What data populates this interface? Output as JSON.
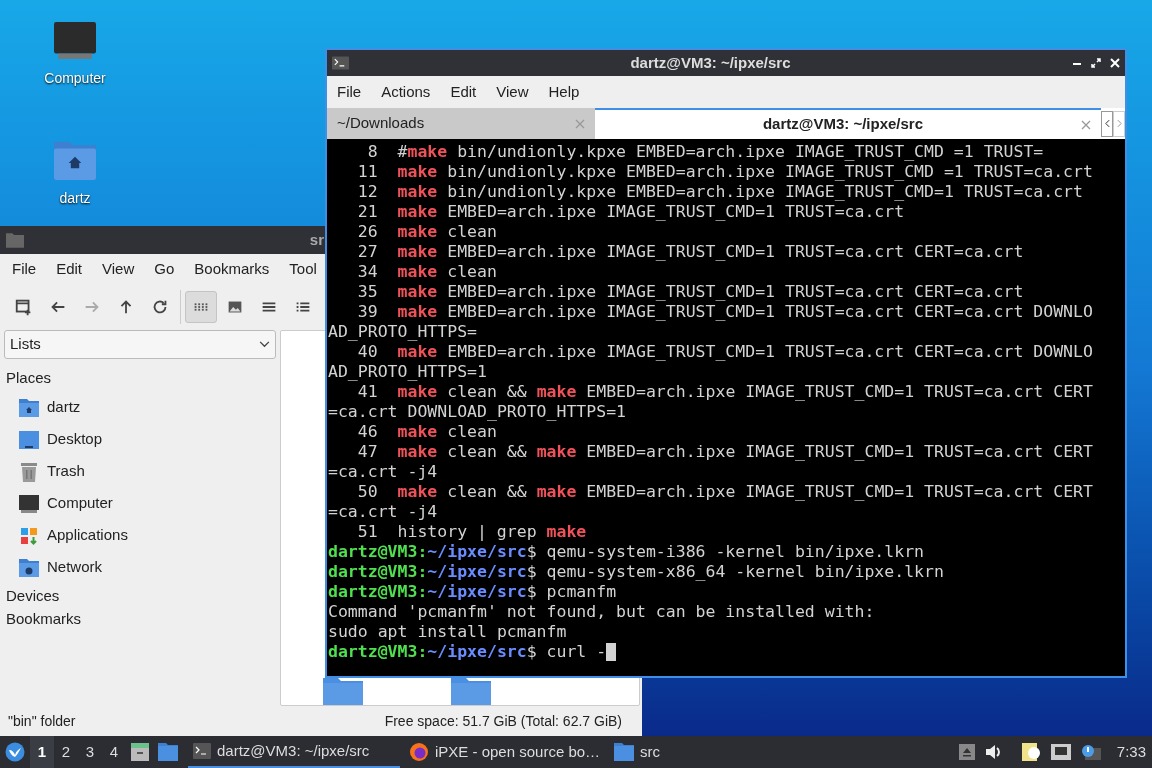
{
  "desktop_icons": [
    {
      "label": "Computer",
      "kind": "computer"
    },
    {
      "label": "dartz",
      "kind": "home"
    }
  ],
  "file_manager": {
    "title": "sr",
    "menu": [
      "File",
      "Edit",
      "View",
      "Go",
      "Bookmarks",
      "Tool"
    ],
    "toolbar": [
      {
        "kind": "new-tab",
        "selected": false
      },
      {
        "kind": "back",
        "selected": false
      },
      {
        "kind": "forward",
        "selected": false
      },
      {
        "kind": "up",
        "selected": false
      },
      {
        "kind": "reload",
        "selected": false
      },
      {
        "kind": "icons",
        "selected": true
      },
      {
        "kind": "thumbnails",
        "selected": false
      },
      {
        "kind": "compact",
        "selected": false
      },
      {
        "kind": "details",
        "selected": false
      }
    ],
    "side_select": "Lists",
    "places_heading": "Places",
    "places": [
      {
        "label": "dartz",
        "kind": "home"
      },
      {
        "label": "Desktop",
        "kind": "desktop"
      },
      {
        "label": "Trash",
        "kind": "trash"
      },
      {
        "label": "Computer",
        "kind": "computer"
      },
      {
        "label": "Applications",
        "kind": "apps"
      },
      {
        "label": "Network",
        "kind": "network"
      }
    ],
    "sections": [
      "Devices",
      "Bookmarks"
    ],
    "status_left": "\"bin\" folder",
    "status_right": "Free space: 51.7 GiB (Total: 62.7 GiB)"
  },
  "terminal": {
    "title": "dartz@VM3: ~/ipxe/src",
    "menu": [
      "File",
      "Actions",
      "Edit",
      "View",
      "Help"
    ],
    "tabs": [
      {
        "label": "~/Downloads",
        "selected": false
      },
      {
        "label": "dartz@VM3: ~/ipxe/src",
        "selected": true
      }
    ],
    "lines": [
      {
        "num": "8",
        "parts": [
          {
            "kind": "text",
            "text": "#"
          },
          {
            "kind": "cmd",
            "text": "make"
          },
          {
            "kind": "text",
            "text": " bin/undionly.kpxe EMBED=arch.ipxe IMAGE_TRUST_CMD =1 TRUST="
          }
        ]
      },
      {
        "num": "11",
        "parts": [
          {
            "kind": "cmd",
            "text": "make"
          },
          {
            "kind": "text",
            "text": " bin/undionly.kpxe EMBED=arch.ipxe IMAGE_TRUST_CMD =1 TRUST=ca.crt"
          }
        ]
      },
      {
        "num": "12",
        "parts": [
          {
            "kind": "cmd",
            "text": "make"
          },
          {
            "kind": "text",
            "text": " bin/undionly.kpxe EMBED=arch.ipxe IMAGE_TRUST_CMD=1 TRUST=ca.crt"
          }
        ]
      },
      {
        "num": "21",
        "parts": [
          {
            "kind": "cmd",
            "text": "make"
          },
          {
            "kind": "text",
            "text": " EMBED=arch.ipxe IMAGE_TRUST_CMD=1 TRUST=ca.crt"
          }
        ]
      },
      {
        "num": "26",
        "parts": [
          {
            "kind": "cmd",
            "text": "make"
          },
          {
            "kind": "text",
            "text": " clean"
          }
        ]
      },
      {
        "num": "27",
        "parts": [
          {
            "kind": "cmd",
            "text": "make"
          },
          {
            "kind": "text",
            "text": " EMBED=arch.ipxe IMAGE_TRUST_CMD=1 TRUST=ca.crt CERT=ca.crt"
          }
        ]
      },
      {
        "num": "34",
        "parts": [
          {
            "kind": "cmd",
            "text": "make"
          },
          {
            "kind": "text",
            "text": " clean"
          }
        ]
      },
      {
        "num": "35",
        "parts": [
          {
            "kind": "cmd",
            "text": "make"
          },
          {
            "kind": "text",
            "text": " EMBED=arch.ipxe IMAGE_TRUST_CMD=1 TRUST=ca.crt CERT=ca.crt"
          }
        ]
      },
      {
        "num": "39",
        "parts": [
          {
            "kind": "cmd",
            "text": "make"
          },
          {
            "kind": "text",
            "text": " EMBED=arch.ipxe IMAGE_TRUST_CMD=1 TRUST=ca.crt CERT=ca.crt DOWNLO"
          }
        ]
      },
      {
        "parts": [
          {
            "kind": "text",
            "text": "AD_PROTO_HTTPS="
          }
        ]
      },
      {
        "num": "40",
        "parts": [
          {
            "kind": "cmd",
            "text": "make"
          },
          {
            "kind": "text",
            "text": " EMBED=arch.ipxe IMAGE_TRUST_CMD=1 TRUST=ca.crt CERT=ca.crt DOWNLO"
          }
        ]
      },
      {
        "parts": [
          {
            "kind": "text",
            "text": "AD_PROTO_HTTPS=1"
          }
        ]
      },
      {
        "num": "41",
        "parts": [
          {
            "kind": "cmd",
            "text": "make"
          },
          {
            "kind": "text",
            "text": " clean && "
          },
          {
            "kind": "cmd",
            "text": "make"
          },
          {
            "kind": "text",
            "text": " EMBED=arch.ipxe IMAGE_TRUST_CMD=1 TRUST=ca.crt CERT"
          }
        ]
      },
      {
        "parts": [
          {
            "kind": "text",
            "text": "=ca.crt DOWNLOAD_PROTO_HTTPS=1"
          }
        ]
      },
      {
        "num": "46",
        "parts": [
          {
            "kind": "cmd",
            "text": "make"
          },
          {
            "kind": "text",
            "text": " clean"
          }
        ]
      },
      {
        "num": "47",
        "parts": [
          {
            "kind": "cmd",
            "text": "make"
          },
          {
            "kind": "text",
            "text": " clean && "
          },
          {
            "kind": "cmd",
            "text": "make"
          },
          {
            "kind": "text",
            "text": " EMBED=arch.ipxe IMAGE_TRUST_CMD=1 TRUST=ca.crt CERT"
          }
        ]
      },
      {
        "parts": [
          {
            "kind": "text",
            "text": "=ca.crt -j4"
          }
        ]
      },
      {
        "num": "50",
        "parts": [
          {
            "kind": "cmd",
            "text": "make"
          },
          {
            "kind": "text",
            "text": " clean && "
          },
          {
            "kind": "cmd",
            "text": "make"
          },
          {
            "kind": "text",
            "text": " EMBED=arch.ipxe IMAGE_TRUST_CMD=1 TRUST=ca.crt CERT"
          }
        ]
      },
      {
        "parts": [
          {
            "kind": "text",
            "text": "=ca.crt -j4"
          }
        ]
      },
      {
        "num": "51",
        "parts": [
          {
            "kind": "text",
            "text": "history | grep "
          },
          {
            "kind": "cmd",
            "text": "make"
          }
        ]
      },
      {
        "parts": [
          {
            "kind": "user",
            "text": "dartz@VM3:"
          },
          {
            "kind": "path",
            "text": "~/ipxe/src"
          },
          {
            "kind": "text",
            "text": "$ qemu-system-i386 -kernel bin/ipxe.lkrn"
          }
        ]
      },
      {
        "parts": [
          {
            "kind": "user",
            "text": "dartz@VM3:"
          },
          {
            "kind": "path",
            "text": "~/ipxe/src"
          },
          {
            "kind": "text",
            "text": "$ qemu-system-x86_64 -kernel bin/ipxe.lkrn"
          }
        ]
      },
      {
        "parts": [
          {
            "kind": "user",
            "text": "dartz@VM3:"
          },
          {
            "kind": "path",
            "text": "~/ipxe/src"
          },
          {
            "kind": "text",
            "text": "$ pcmanfm"
          }
        ]
      },
      {
        "parts": [
          {
            "kind": "text",
            "text": "Command 'pcmanfm' not found, but can be installed with:"
          }
        ]
      },
      {
        "parts": [
          {
            "kind": "text",
            "text": "sudo apt install pcmanfm"
          }
        ]
      },
      {
        "parts": [
          {
            "kind": "user",
            "text": "dartz@VM3:"
          },
          {
            "kind": "path",
            "text": "~/ipxe/src"
          },
          {
            "kind": "text",
            "text": "$ curl -"
          }
        ],
        "cursor": true
      }
    ]
  },
  "taskbar": {
    "workspaces": [
      {
        "label": "1",
        "selected": true
      },
      {
        "label": "2",
        "selected": false
      },
      {
        "label": "3",
        "selected": false
      },
      {
        "label": "4",
        "selected": false
      }
    ],
    "tasks": [
      {
        "label": "dartz@VM3: ~/ipxe/src",
        "kind": "terminal",
        "selected": true
      },
      {
        "label": "iPXE - open source bo…",
        "kind": "browser",
        "selected": false
      },
      {
        "label": "src",
        "kind": "folder",
        "selected": false
      }
    ],
    "clock": "7:33"
  }
}
